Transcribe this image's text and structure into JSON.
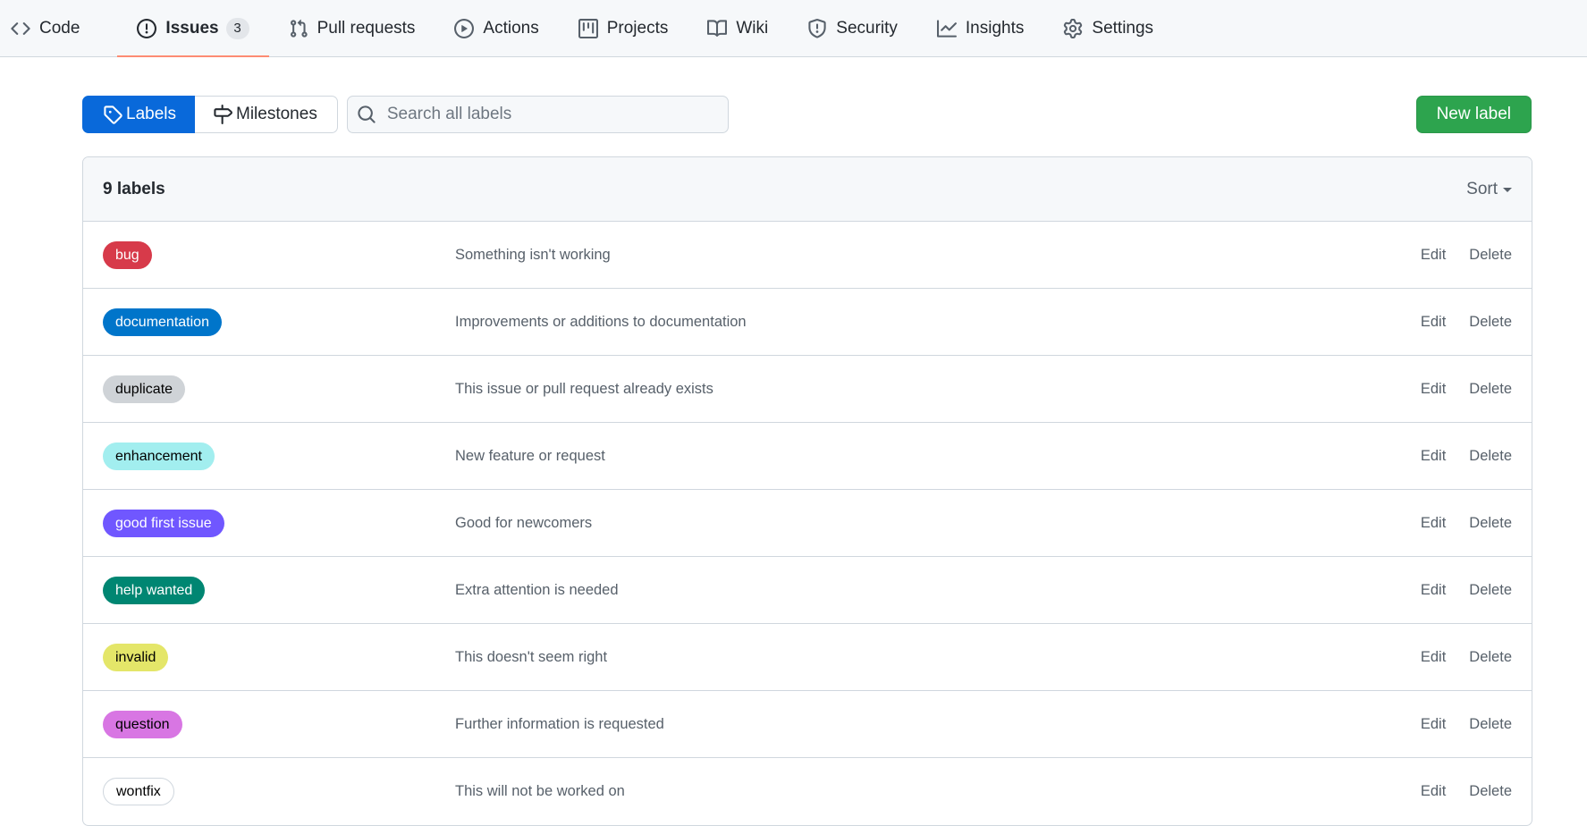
{
  "nav": {
    "tabs": [
      {
        "label": "Code",
        "icon": "code-icon"
      },
      {
        "label": "Issues",
        "icon": "issue-opened-icon",
        "count": "3"
      },
      {
        "label": "Pull requests",
        "icon": "git-pull-request-icon"
      },
      {
        "label": "Actions",
        "icon": "play-icon"
      },
      {
        "label": "Projects",
        "icon": "table-icon"
      },
      {
        "label": "Wiki",
        "icon": "book-icon"
      },
      {
        "label": "Security",
        "icon": "shield-icon"
      },
      {
        "label": "Insights",
        "icon": "graph-icon"
      },
      {
        "label": "Settings",
        "icon": "gear-icon"
      }
    ],
    "active_tab": "Issues",
    "active_underline_color": "#fd8c73"
  },
  "subnav": {
    "labels_label": "Labels",
    "milestones_label": "Milestones",
    "search_placeholder": "Search all labels",
    "new_label": "New label"
  },
  "box": {
    "count": "9 labels",
    "sort_label": "Sort"
  },
  "labels": [
    {
      "name": "bug",
      "description": "Something isn't working",
      "bg": "#d73a4a",
      "fg": "#ffffff"
    },
    {
      "name": "documentation",
      "description": "Improvements or additions to documentation",
      "bg": "#0075ca",
      "fg": "#ffffff"
    },
    {
      "name": "duplicate",
      "description": "This issue or pull request already exists",
      "bg": "#cfd3d7",
      "fg": "#000000"
    },
    {
      "name": "enhancement",
      "description": "New feature or request",
      "bg": "#a2eeef",
      "fg": "#000000"
    },
    {
      "name": "good first issue",
      "description": "Good for newcomers",
      "bg": "#7057ff",
      "fg": "#ffffff"
    },
    {
      "name": "help wanted",
      "description": "Extra attention is needed",
      "bg": "#008672",
      "fg": "#ffffff"
    },
    {
      "name": "invalid",
      "description": "This doesn't seem right",
      "bg": "#e4e669",
      "fg": "#000000"
    },
    {
      "name": "question",
      "description": "Further information is requested",
      "bg": "#d876e3",
      "fg": "#000000"
    },
    {
      "name": "wontfix",
      "description": "This will not be worked on",
      "bg": "#ffffff",
      "fg": "#000000",
      "border": "#d0d7de"
    }
  ],
  "row_actions": {
    "edit": "Edit",
    "delete": "Delete"
  }
}
